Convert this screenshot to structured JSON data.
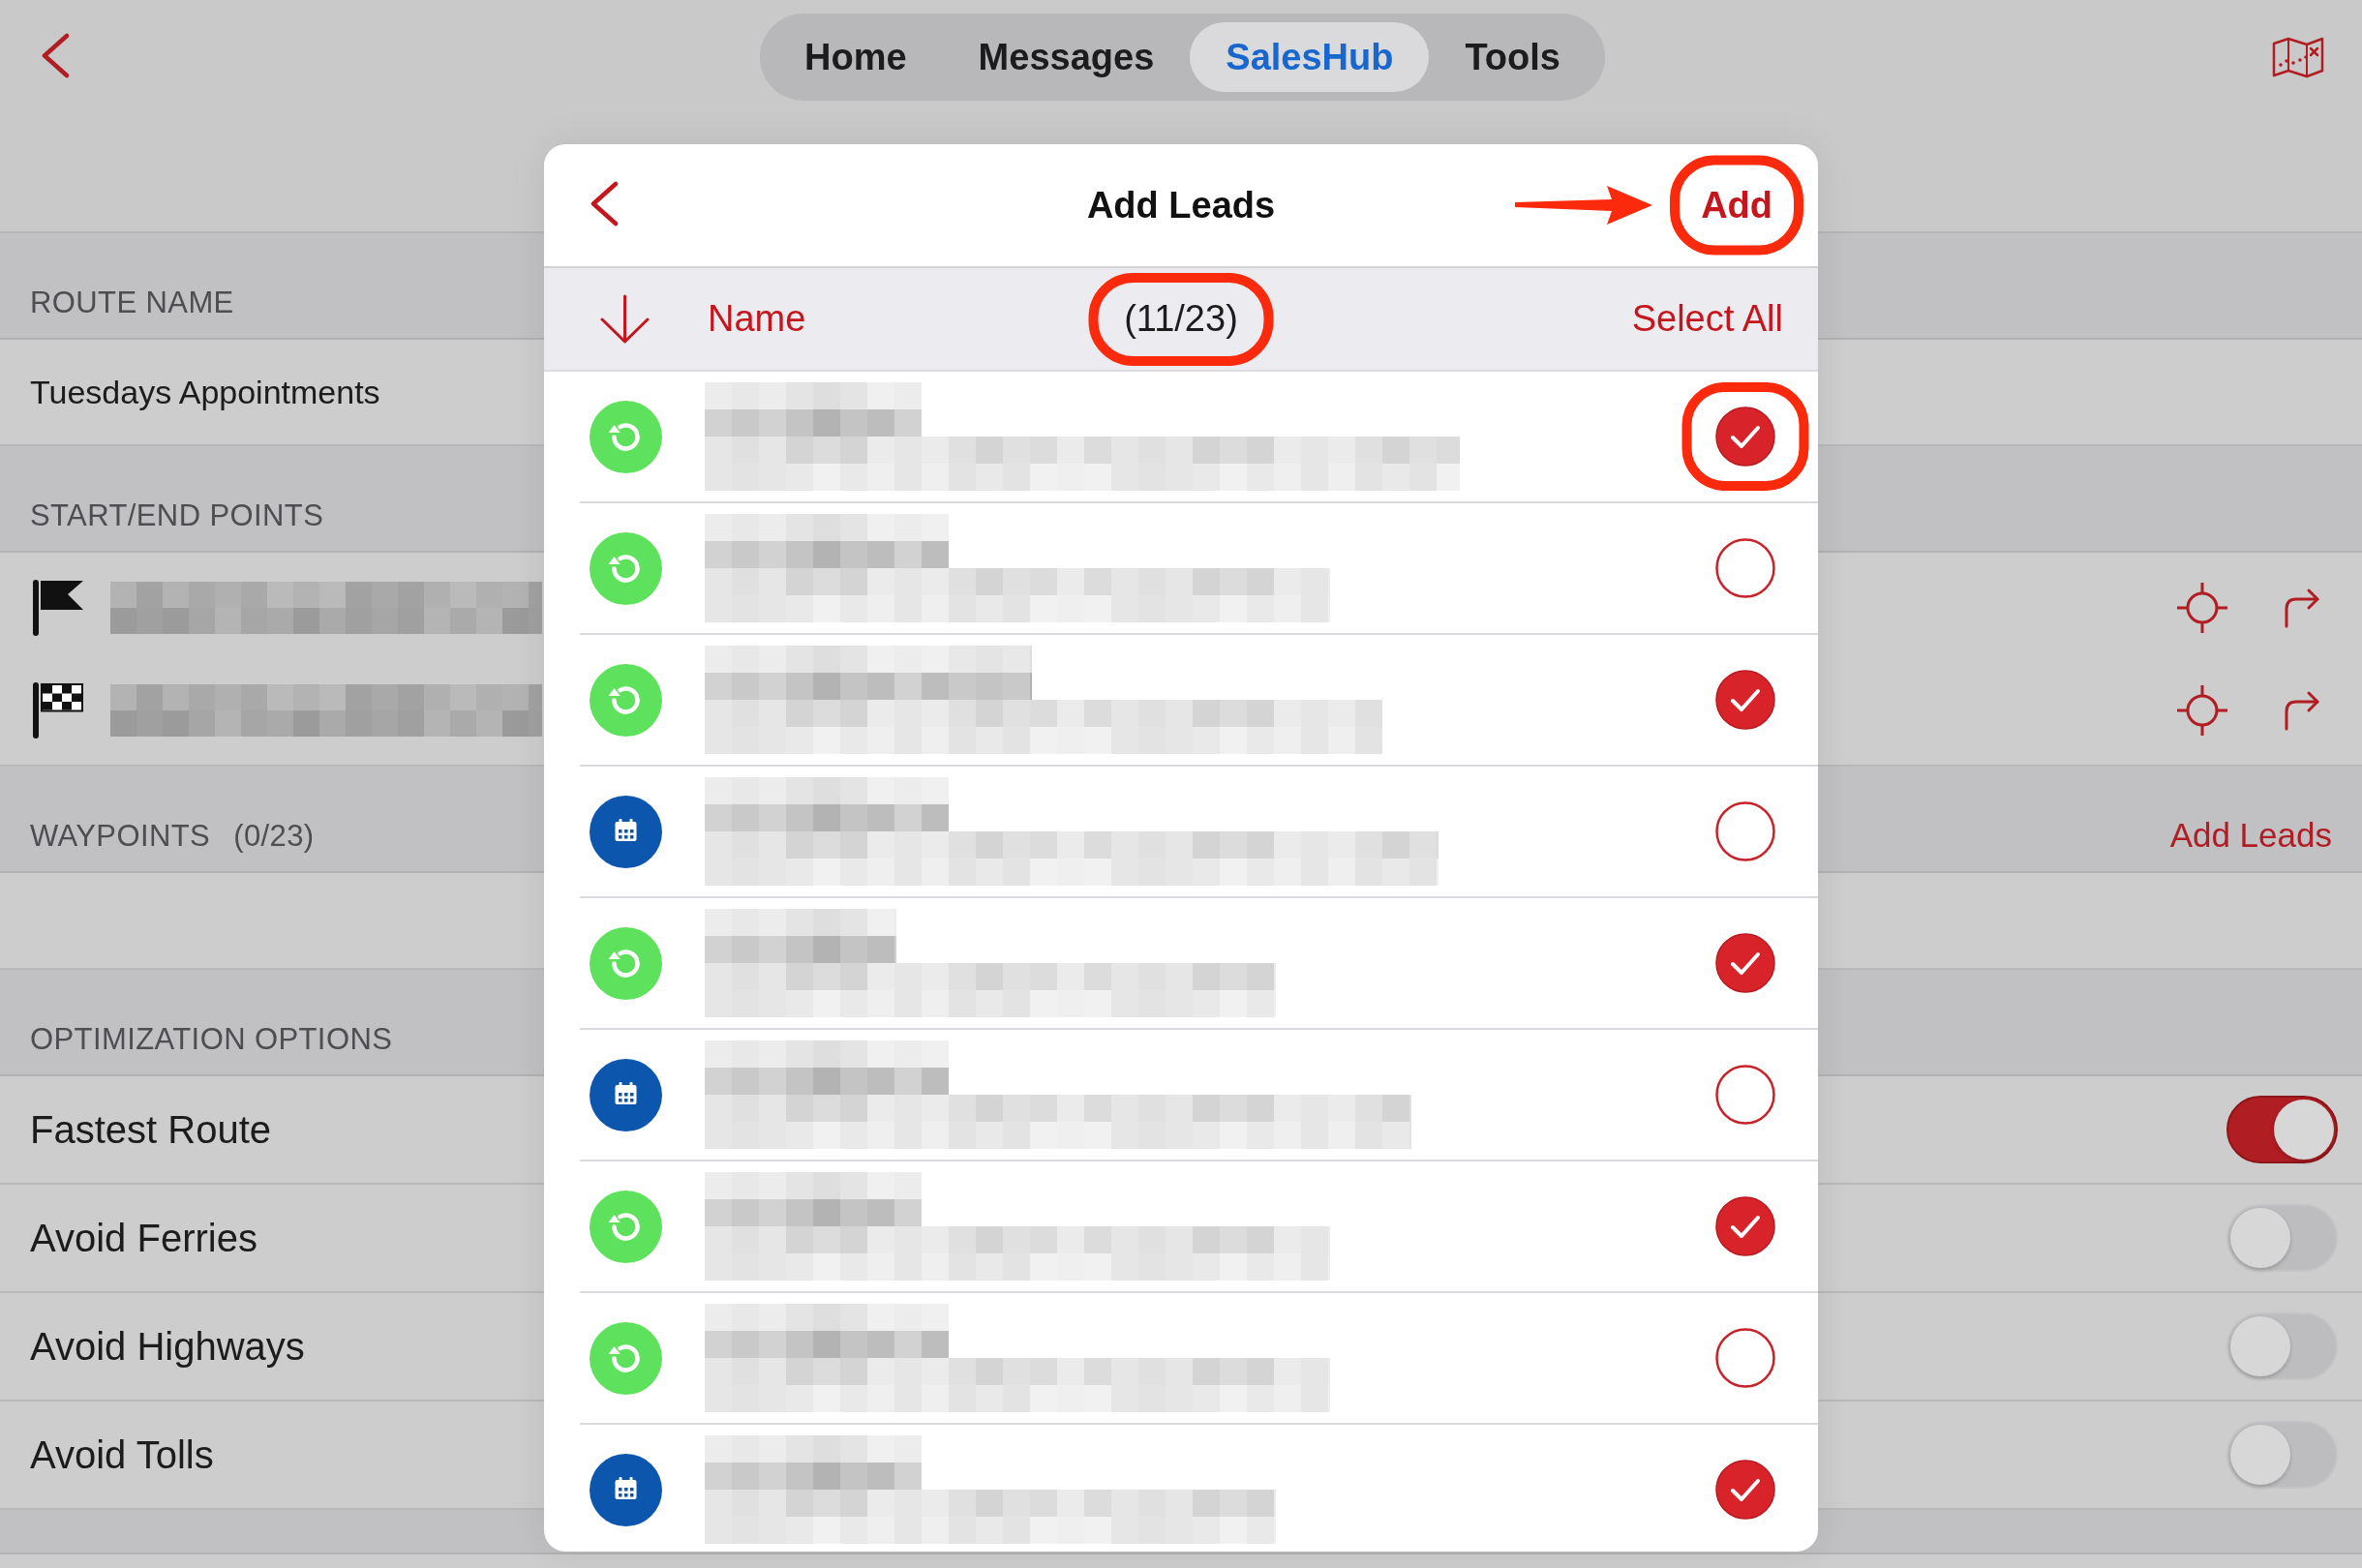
{
  "nav": {
    "tabs": [
      {
        "label": "Home",
        "selected": false
      },
      {
        "label": "Messages",
        "selected": false
      },
      {
        "label": "SalesHub",
        "selected": true
      },
      {
        "label": "Tools",
        "selected": false
      }
    ]
  },
  "route_name": {
    "header": "ROUTE NAME",
    "value": "Tuesdays Appointments"
  },
  "start_end_points": {
    "header": "START/END POINTS",
    "points": [
      {
        "kind": "start"
      },
      {
        "kind": "end"
      }
    ]
  },
  "waypoints": {
    "header": "WAYPOINTS",
    "count": "(0/23)",
    "action": "Add Leads"
  },
  "optimization_options": {
    "header": "OPTIMIZATION OPTIONS",
    "options": [
      {
        "label": "Fastest Route",
        "on": true
      },
      {
        "label": "Avoid Ferries",
        "on": false
      },
      {
        "label": "Avoid Highways",
        "on": false
      },
      {
        "label": "Avoid Tolls",
        "on": false
      }
    ]
  },
  "add_leads_dialog": {
    "title": "Add Leads",
    "add_button": {
      "label": "Add",
      "highlighted": true,
      "arrow": true
    },
    "sort_column": "Name",
    "selection_count": {
      "text": "(11/23)",
      "highlighted": true
    },
    "select_all": "Select All",
    "leads": [
      {
        "kind": "cycle",
        "checked": true,
        "highlighted": true
      },
      {
        "kind": "cycle",
        "checked": false,
        "highlighted": false
      },
      {
        "kind": "cycle",
        "checked": true,
        "highlighted": false
      },
      {
        "kind": "calendar",
        "checked": false,
        "highlighted": false
      },
      {
        "kind": "cycle",
        "checked": true,
        "highlighted": false
      },
      {
        "kind": "calendar",
        "checked": false,
        "highlighted": false
      },
      {
        "kind": "cycle",
        "checked": true,
        "highlighted": false
      },
      {
        "kind": "cycle",
        "checked": false,
        "highlighted": false
      },
      {
        "kind": "calendar",
        "checked": true,
        "highlighted": false
      }
    ]
  }
}
